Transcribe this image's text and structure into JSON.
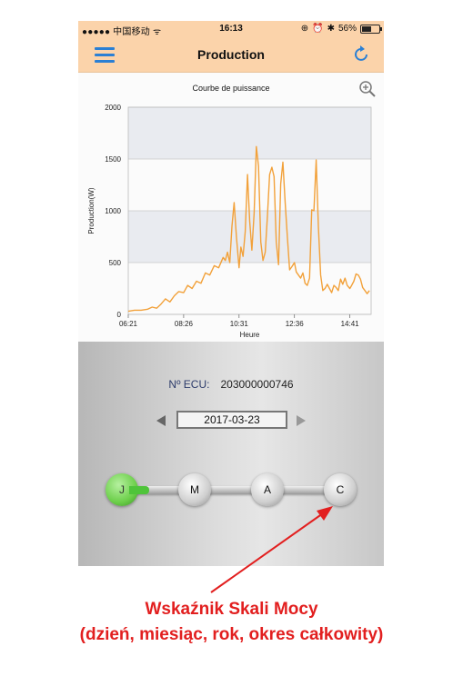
{
  "status_bar": {
    "carrier": "●●●●● 中国移动 ᯤ",
    "time": "16:13",
    "battery": "56%"
  },
  "nav": {
    "title": "Production",
    "menu_icon": "hamburger-icon",
    "refresh_icon": "refresh-icon"
  },
  "chart_data": {
    "type": "line",
    "title": "Courbe de puissance",
    "xlabel": "Heure",
    "ylabel": "Production(W)",
    "ylim": [
      0,
      2000
    ],
    "yticks": [
      "0",
      "500",
      "1000",
      "1500",
      "2000"
    ],
    "xticks": [
      "06:21",
      "08:26",
      "10:31",
      "12:36",
      "14:41"
    ],
    "series": [
      {
        "color": "#f2a13a",
        "x": [
          "06:21",
          "06:35",
          "06:50",
          "07:05",
          "07:15",
          "07:25",
          "07:35",
          "07:45",
          "07:55",
          "08:05",
          "08:15",
          "08:26",
          "08:35",
          "08:45",
          "08:55",
          "09:05",
          "09:15",
          "09:25",
          "09:35",
          "09:45",
          "09:55",
          "10:00",
          "10:05",
          "10:10",
          "10:15",
          "10:20",
          "10:25",
          "10:31",
          "10:35",
          "10:40",
          "10:45",
          "10:50",
          "10:55",
          "11:00",
          "11:05",
          "11:10",
          "11:15",
          "11:20",
          "11:25",
          "11:30",
          "11:35",
          "11:40",
          "11:45",
          "11:50",
          "11:55",
          "12:00",
          "12:05",
          "12:10",
          "12:15",
          "12:20",
          "12:25",
          "12:30",
          "12:36",
          "12:40",
          "12:45",
          "12:50",
          "12:55",
          "13:00",
          "13:05",
          "13:10",
          "13:15",
          "13:20",
          "13:25",
          "13:30",
          "13:35",
          "13:40",
          "13:45",
          "13:50",
          "13:55",
          "14:00",
          "14:05",
          "14:10",
          "14:15",
          "14:20",
          "14:25",
          "14:30",
          "14:35",
          "14:41",
          "14:45",
          "14:50",
          "14:55",
          "15:00",
          "15:05",
          "15:10",
          "15:15",
          "15:20",
          "15:25"
        ],
        "y": [
          30,
          40,
          40,
          50,
          70,
          60,
          100,
          150,
          120,
          180,
          220,
          210,
          280,
          250,
          320,
          300,
          400,
          380,
          470,
          450,
          550,
          520,
          600,
          500,
          850,
          1080,
          750,
          450,
          650,
          560,
          800,
          1350,
          900,
          620,
          980,
          1620,
          1430,
          700,
          520,
          600,
          950,
          1350,
          1420,
          1330,
          700,
          480,
          1260,
          1470,
          1080,
          750,
          430,
          460,
          500,
          410,
          380,
          350,
          400,
          300,
          280,
          350,
          1010,
          1000,
          1490,
          850,
          380,
          230,
          250,
          290,
          250,
          210,
          280,
          260,
          230,
          340,
          290,
          350,
          280,
          250,
          280,
          320,
          390,
          380,
          340,
          260,
          230,
          200,
          230
        ]
      }
    ]
  },
  "panel": {
    "ecu_label": "Nº ECU:",
    "ecu_value": "203000000746",
    "date": "2017-03-23",
    "scale_buttons": [
      "J",
      "M",
      "A",
      "C"
    ],
    "active_index": 0
  },
  "caption": {
    "line1": "Wskaźnik Skali Mocy",
    "line2": "(dzień, miesiąc, rok, okres całkowity)",
    "color": "#e21f1f"
  }
}
